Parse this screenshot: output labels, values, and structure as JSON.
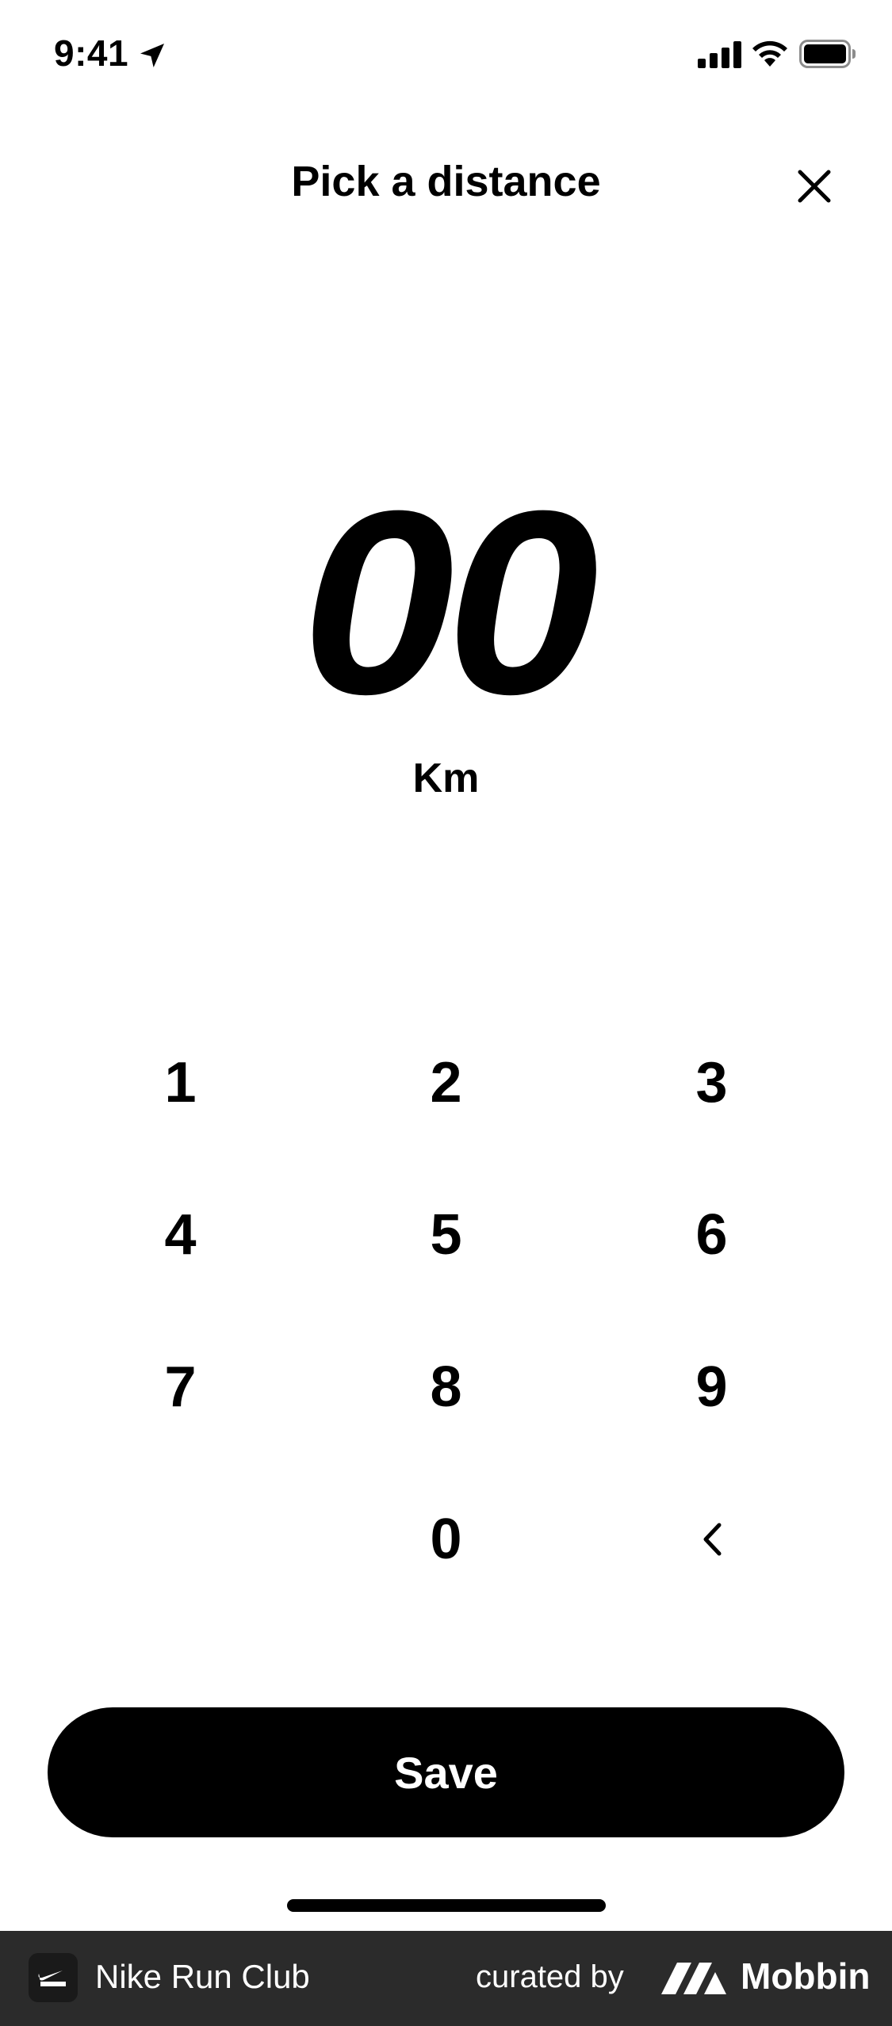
{
  "status_bar": {
    "time": "9:41"
  },
  "header": {
    "title": "Pick a distance"
  },
  "display": {
    "value": "00",
    "unit": "Km"
  },
  "keypad": {
    "rows": [
      [
        "1",
        "2",
        "3"
      ],
      [
        "4",
        "5",
        "6"
      ],
      [
        "7",
        "8",
        "9"
      ],
      [
        "",
        "0",
        "<"
      ]
    ]
  },
  "actions": {
    "save_label": "Save"
  },
  "footer": {
    "app_name": "Nike Run Club",
    "curated_by": "curated by",
    "brand": "Mobbin"
  },
  "icons": {
    "close": "close-icon",
    "location": "location-arrow-icon",
    "signal": "signal-icon",
    "wifi": "wifi-icon",
    "battery": "battery-icon",
    "backspace": "chevron-left-icon"
  },
  "colors": {
    "primary": "#000000",
    "background": "#ffffff",
    "footer": "#2b2b2b"
  }
}
